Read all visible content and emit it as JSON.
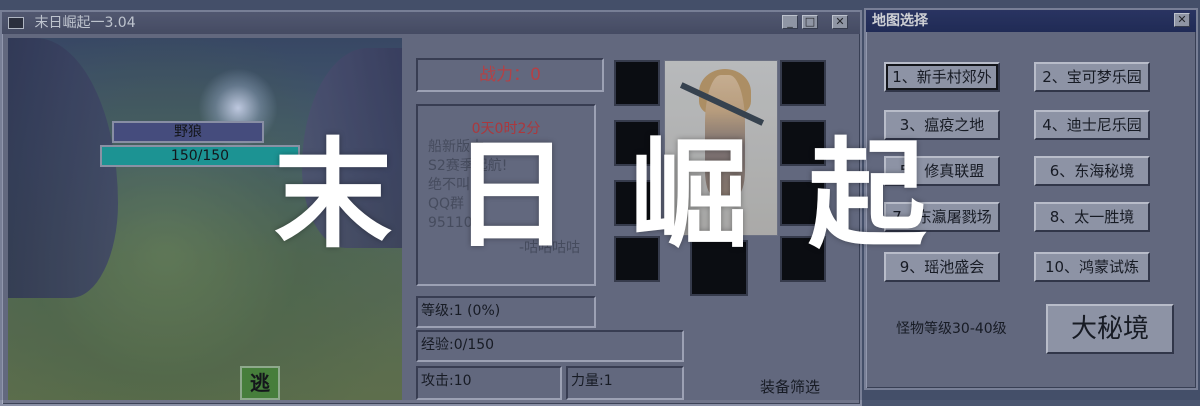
{
  "banner": {
    "text": "末日崛起"
  },
  "game_window": {
    "title": "末日崛起一3.04",
    "controls": {
      "minimize": "_",
      "maximize": "□",
      "close": "✕"
    },
    "battle": {
      "enemy_name": "野狼",
      "enemy_hp": "150/150",
      "flee_label": "逃"
    },
    "power_label": "战力：0",
    "notice": {
      "timer": "0天0时2分",
      "lines": [
        "船新版本",
        "S2赛季起航!",
        "绝不叫",
        "QQ群",
        "95110"
      ],
      "signature": "-咕咕咕咕"
    },
    "stats": {
      "level": "等级:1 (0%)",
      "exp": "经验:0/150",
      "attack": "攻击:10",
      "strength": "力量:1"
    },
    "equip_filter_label": "装备筛选"
  },
  "map_window": {
    "title": "地图选择",
    "close": "✕",
    "maps": [
      "1、新手村郊外",
      "2、宝可梦乐园",
      "3、瘟疫之地",
      "4、迪士尼乐园",
      "5、修真联盟",
      "6、东海秘境",
      "7、东瀛屠戮场",
      "8、太一胜境",
      "9、瑶池盛会",
      "10、鸿蒙试炼"
    ],
    "selected_index": 0,
    "monster_level": "怪物等级30-40级",
    "secret_button": "大秘境"
  },
  "colors": {
    "power": "#d24545",
    "timer": "#c83a3a",
    "hp_bar": "#1aa9a3",
    "flee": "#4d8f38"
  }
}
